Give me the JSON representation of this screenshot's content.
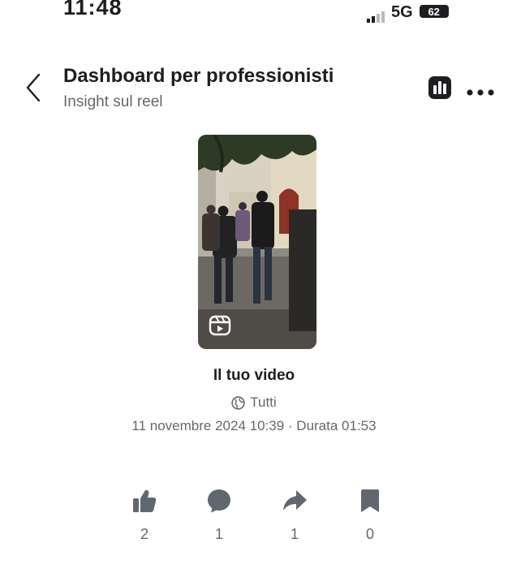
{
  "status_bar": {
    "time": "11:48",
    "network": "5G",
    "battery": "62"
  },
  "header": {
    "title": "Dashboard per professionisti",
    "subtitle": "Insight sul reel"
  },
  "video": {
    "title": "Il tuo video",
    "audience": "Tutti",
    "meta": "11 novembre 2024 10:39 · Durata 01:53"
  },
  "stats": {
    "likes": "2",
    "comments": "1",
    "shares": "1",
    "saves": "0"
  },
  "icons": {
    "back": "chevron-left-icon",
    "insights": "bar-chart-icon",
    "more": "ellipsis-icon",
    "reel": "reel-icon",
    "audience": "globe-icon",
    "likes": "thumbs-up-icon",
    "comments": "comment-bubble-icon",
    "shares": "share-arrow-icon",
    "saves": "bookmark-icon"
  },
  "colors": {
    "text_primary": "#1c1e21",
    "text_secondary": "#65676b",
    "icon": "#606770"
  }
}
